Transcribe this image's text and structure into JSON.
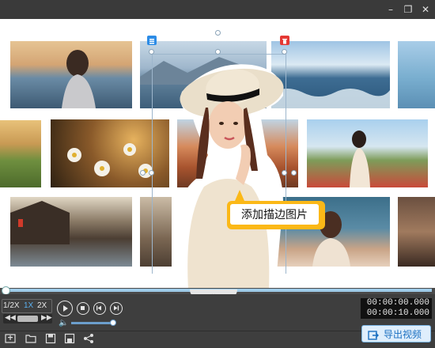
{
  "window": {
    "buttons": {
      "minimize": "–",
      "restore": "❐",
      "close": "✕"
    }
  },
  "canvas": {
    "photos": [
      {
        "name": "woman-beach"
      },
      {
        "name": "lake-mountains"
      },
      {
        "name": "ocean-waves"
      },
      {
        "name": "coast-right"
      },
      {
        "name": "vineyard"
      },
      {
        "name": "daisies"
      },
      {
        "name": "red-canyon"
      },
      {
        "name": "woman-flower-field"
      },
      {
        "name": "water-town"
      },
      {
        "name": "street-left"
      },
      {
        "name": "woman-street"
      },
      {
        "name": "woman-right-edge"
      }
    ],
    "tooltip": {
      "text": "添加描边图片"
    },
    "selection": {
      "list_icon": "list-icon",
      "delete_icon": "trash-icon"
    }
  },
  "playback": {
    "speeds": [
      "1/2X",
      "1X",
      "2X"
    ],
    "active_speed": "1X",
    "current_time": "00:00:00.000",
    "total_time": "00:00:10.000",
    "progress": 0.0,
    "volume": 0.85
  },
  "toolbar": {
    "export_label": "导出视频",
    "tools": [
      "add-media-icon",
      "open-folder-icon",
      "save-icon",
      "save-as-icon",
      "share-icon"
    ]
  },
  "colors": {
    "accent": "#1a6fc0",
    "tooltip": "#fbb817",
    "delete": "#e53935",
    "list": "#2d8ce6"
  }
}
